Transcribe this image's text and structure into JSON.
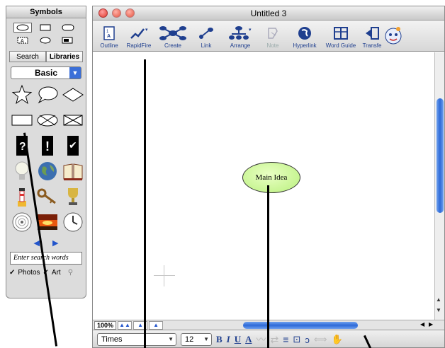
{
  "palette": {
    "title": "Symbols",
    "tabs": [
      {
        "label": "Search"
      },
      {
        "label": "Libraries"
      }
    ],
    "category": "Basic",
    "search_placeholder": "Enter search words",
    "filters": [
      {
        "label": "Photos",
        "checked": true
      },
      {
        "label": "Art",
        "checked": true
      }
    ]
  },
  "window": {
    "title": "Untitled 3",
    "toolbar": [
      {
        "label": "Outline",
        "icon": "outline-icon"
      },
      {
        "label": "RapidFire",
        "icon": "rapidfire-icon"
      },
      {
        "label": "Create",
        "icon": "create-icon"
      },
      {
        "label": "Link",
        "icon": "link-icon"
      },
      {
        "label": "Arrange",
        "icon": "arrange-icon"
      },
      {
        "label": "Note",
        "icon": "note-icon"
      },
      {
        "label": "Hyperlink",
        "icon": "hyperlink-icon"
      },
      {
        "label": "Word Guide",
        "icon": "word-guide-icon"
      },
      {
        "label": "Transfe",
        "icon": "transfer-icon"
      }
    ],
    "node": {
      "label": "Main Idea"
    },
    "zoom": "100%",
    "format": {
      "font": "Times",
      "size": "12",
      "bold": "B",
      "italic": "I",
      "underline": "U",
      "color": "A"
    }
  },
  "colors": {
    "node_fill": "#c6f58e",
    "scroll_thumb": "#2d6ad8",
    "toolbar_label": "#1f3f8f"
  }
}
